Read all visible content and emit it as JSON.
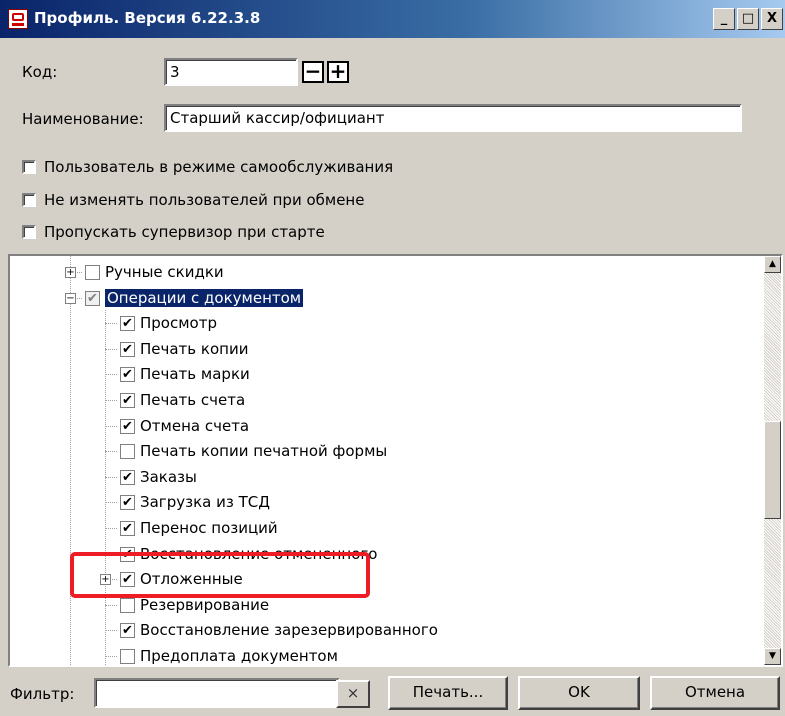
{
  "window": {
    "title": "Профиль. Версия 6.22.3.8",
    "minimize": "_",
    "maximize": "□",
    "close": "X"
  },
  "fields": {
    "code_label": "Код:",
    "code_value": "3",
    "minus": "−",
    "plus": "+",
    "name_label": "Наименование:",
    "name_value": "Старший кассир/официант"
  },
  "options": [
    {
      "label": "Пользователь в режиме самообслуживания",
      "checked": false
    },
    {
      "label": "Не изменять пользователей при обмене",
      "checked": false
    },
    {
      "label": "Пропускать супервизор при старте",
      "checked": false
    }
  ],
  "tree": {
    "items": [
      {
        "label": "Ручные скидки",
        "level": 0,
        "expander": "+",
        "check": "empty"
      },
      {
        "label": "Операции с документом",
        "level": 0,
        "expander": "−",
        "check": "grey",
        "selected": true
      },
      {
        "label": "Просмотр",
        "level": 1,
        "check": "checked"
      },
      {
        "label": "Печать копии",
        "level": 1,
        "check": "checked"
      },
      {
        "label": "Печать марки",
        "level": 1,
        "check": "checked"
      },
      {
        "label": "Печать счета",
        "level": 1,
        "check": "checked"
      },
      {
        "label": "Отмена счета",
        "level": 1,
        "check": "checked"
      },
      {
        "label": "Печать копии печатной формы",
        "level": 1,
        "check": "empty"
      },
      {
        "label": "Заказы",
        "level": 1,
        "check": "checked"
      },
      {
        "label": "Загрузка из ТСД",
        "level": 1,
        "check": "checked"
      },
      {
        "label": "Перенос позиций",
        "level": 1,
        "check": "checked"
      },
      {
        "label": "Восстановление отмененного",
        "level": 1,
        "check": "checked"
      },
      {
        "label": "Отложенные",
        "level": 1,
        "expander": "+",
        "check": "checked"
      },
      {
        "label": "Резервирование",
        "level": 1,
        "check": "empty"
      },
      {
        "label": "Восстановление зарезервированного",
        "level": 1,
        "check": "checked"
      },
      {
        "label": "Предоплата документом",
        "level": 1,
        "check": "empty"
      }
    ]
  },
  "footer": {
    "filter_label": "Фильтр:",
    "filter_value": "",
    "clear": "×",
    "print": "Печать...",
    "ok": "OK",
    "cancel": "Отмена"
  },
  "colors": {
    "highlight": "#ee1c24",
    "selection": "#0a246a"
  }
}
